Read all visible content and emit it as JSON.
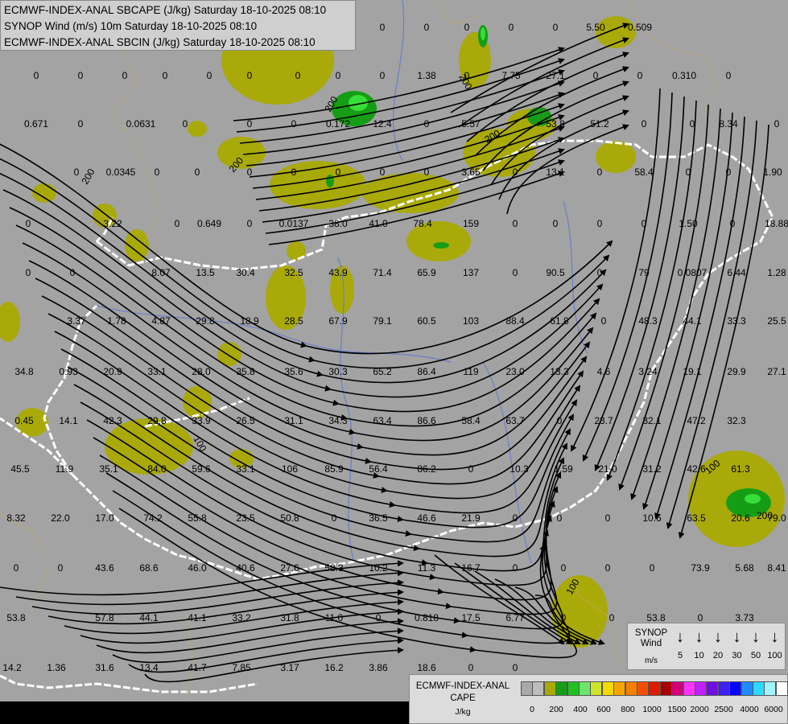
{
  "title_lines": [
    "ECMWF-INDEX-ANAL SBCAPE (J/kg) Saturday 18-10-2025 08:10",
    "SYNOP Wind (m/s) 10m Saturday 18-10-2025 08:10",
    "ECMWF-INDEX-ANAL SBCIN (J/kg) Saturday 18-10-2025 08:10"
  ],
  "colors": {
    "background": "#a3a3a3",
    "cape_low": "#a9a90a",
    "cape_mid": "#169d16",
    "cape_high": "#38de38",
    "streamline": "#000000",
    "country_border": "#ffffff",
    "river": "#6c7ec8",
    "admin_border": "#c8a866"
  },
  "contour_labels": [
    "200",
    "200",
    "200",
    "200",
    "200",
    "200",
    "100",
    "100",
    "100"
  ],
  "station_values": [
    "0",
    "0",
    "0",
    "0",
    "0",
    "0",
    "0",
    "0",
    "0",
    "0",
    "0",
    "5.50",
    "0.509",
    "0",
    "0",
    "0",
    "0",
    "0",
    "0",
    "0",
    "0",
    "0",
    "1.38",
    "0",
    "7.75",
    "27.1",
    "0",
    "0",
    "0.310",
    "0",
    "0.671",
    "0",
    "0.0631",
    "0",
    "0",
    "0",
    "0.172",
    "12.4",
    "0",
    "5.57",
    "53.8",
    "51.2",
    "0",
    "0",
    "8.34",
    "0",
    "0",
    "0.0345",
    "0",
    "0",
    "0",
    "0",
    "0",
    "0",
    "0",
    "3.65",
    "0",
    "13.1",
    "0",
    "58.4",
    "0",
    "0",
    "1.90",
    "0",
    "3.22",
    "0",
    "0.649",
    "0",
    "0.0137",
    "38.0",
    "41.0",
    "78.4",
    "159",
    "0",
    "0",
    "0",
    "0",
    "1.50",
    "0",
    "18.88",
    "0",
    "0",
    "8.07",
    "13.5",
    "30.4",
    "32.5",
    "43.9",
    "71.4",
    "65.9",
    "137",
    "0",
    "90.5",
    "0",
    "79",
    "0.0807",
    "6.44",
    "1.28",
    "3.37",
    "1.78",
    "4.87",
    "29.8",
    "18.9",
    "28.5",
    "67.9",
    "79.1",
    "60.5",
    "103",
    "88.4",
    "61.8",
    "0",
    "48.3",
    "44.1",
    "33.3",
    "25.5",
    "34.8",
    "0.93",
    "20.9",
    "33.1",
    "28.0",
    "35.8",
    "35.6",
    "30.3",
    "65.2",
    "86.4",
    "119",
    "23.0",
    "13.3",
    "4.6",
    "3.24",
    "19.1",
    "29.9",
    "27.1",
    "0.45",
    "14.1",
    "42.3",
    "29.8",
    "33.9",
    "26.5",
    "31.1",
    "34.3",
    "63.4",
    "86.6",
    "58.4",
    "63.7",
    "0",
    "23.7",
    "32.1",
    "47.2",
    "32.3",
    "45.5",
    "11.9",
    "35.1",
    "84.0",
    "59.6",
    "33.1",
    "106",
    "85.9",
    "56.4",
    "86.2",
    "0",
    "10.3",
    "1.59",
    "21.0",
    "31.2",
    "42.6",
    "61.3",
    "8.32",
    "22.0",
    "17.0",
    "74.2",
    "55.8",
    "23.5",
    "50.8",
    "0",
    "36.5",
    "46.6",
    "21.9",
    "0",
    "0",
    "0",
    "10.6",
    "63.5",
    "20.6",
    "79.0",
    "0",
    "0",
    "43.6",
    "68.6",
    "46.0",
    "40.6",
    "27.6",
    "58.3",
    "10.2",
    "11.3",
    "16.7",
    "0",
    "0",
    "0",
    "0",
    "73.9",
    "5.68",
    "8.41",
    "53.8",
    "57.8",
    "44.1",
    "41.1",
    "33.2",
    "31.8",
    "11.0",
    "0",
    "0.818",
    "17.5",
    "6.77",
    "0",
    "0",
    "53.8",
    "0",
    "3.73",
    "14.2",
    "1.36",
    "31.6",
    "13.4",
    "41.7",
    "7.85",
    "3.17",
    "16.2",
    "3.86",
    "18.6",
    "0",
    "0"
  ],
  "wind_legend": {
    "label": "SYNOP\nWind",
    "unit": "m/s",
    "arrow_icon": "down-arrow-icon",
    "speeds": [
      "5",
      "10",
      "20",
      "30",
      "50",
      "100"
    ]
  },
  "cape_legend": {
    "title": "ECMWF-INDEX-ANAL\nCAPE",
    "unit": "J/kg",
    "swatches": [
      "#a8a8a8",
      "#bdbdbd",
      "#a9a90a",
      "#169d16",
      "#22c022",
      "#6ee36e",
      "#cde32a",
      "#f5d900",
      "#f5a500",
      "#f57f00",
      "#f05000",
      "#dc1c00",
      "#a80000",
      "#d4007a",
      "#ff32ff",
      "#c020ff",
      "#7010e0",
      "#4020f0",
      "#0000ff",
      "#1e8cff",
      "#30d8ff",
      "#9ef5ff",
      "#ffffff"
    ],
    "ticks": [
      "0",
      "200",
      "400",
      "600",
      "800",
      "1000",
      "1500",
      "2000",
      "2500",
      "4000",
      "6000"
    ]
  }
}
